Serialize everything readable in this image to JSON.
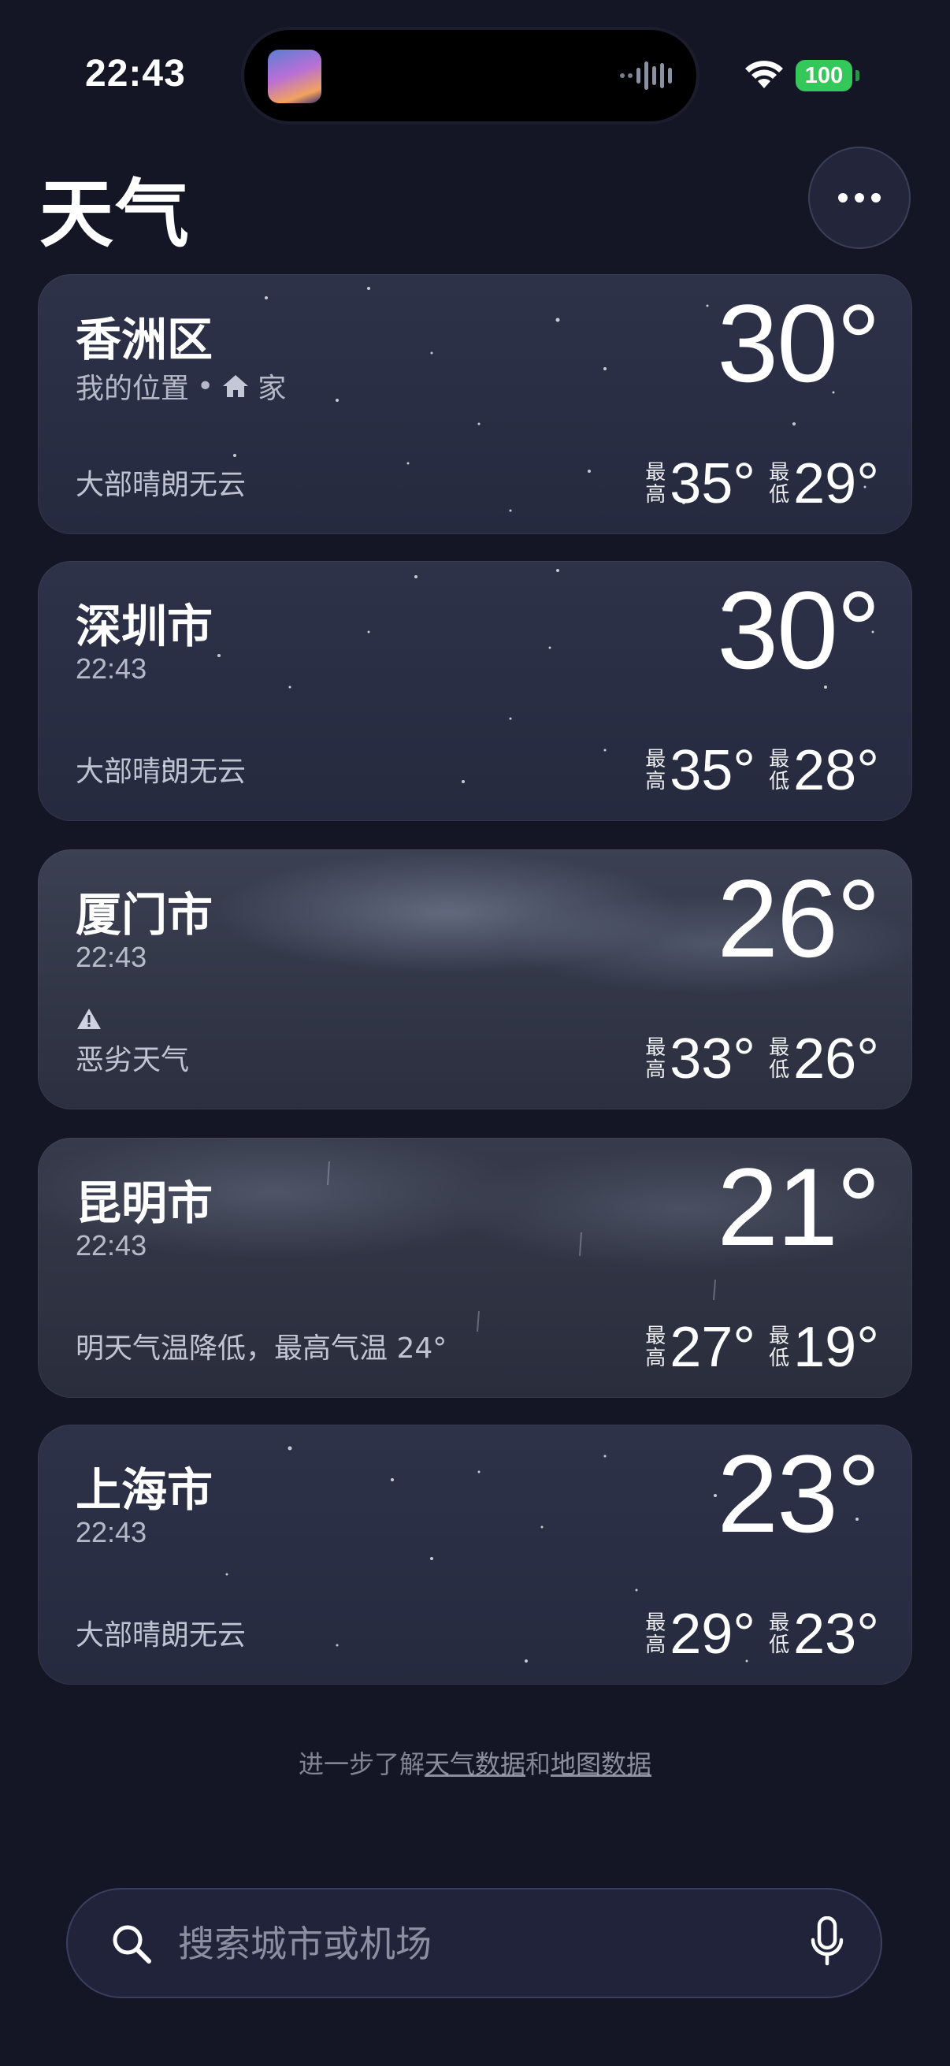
{
  "status_bar": {
    "time": "22:43",
    "battery": "100",
    "wifi_icon": "wifi-icon",
    "now_playing_icon": "audio-wave-icon"
  },
  "header": {
    "title": "天气",
    "more_icon": "ellipsis-icon"
  },
  "labels": {
    "high": "最高",
    "low": "最低"
  },
  "cards": [
    {
      "city": "香洲区",
      "subtitle": "我的位置",
      "separator": "•",
      "home_label": "家",
      "condition": "大部晴朗无云",
      "temp": "30°",
      "high": "35°",
      "low": "29°",
      "style": "night-clear"
    },
    {
      "city": "深圳市",
      "subtitle": "22:43",
      "condition": "大部晴朗无云",
      "temp": "30°",
      "high": "35°",
      "low": "28°",
      "style": "night-clear"
    },
    {
      "city": "厦门市",
      "subtitle": "22:43",
      "condition": "恶劣天气",
      "alert_icon": "warning-icon",
      "temp": "26°",
      "high": "33°",
      "low": "26°",
      "style": "cloudy"
    },
    {
      "city": "昆明市",
      "subtitle": "22:43",
      "condition": "明天气温降低，最高气温 24°",
      "temp": "21°",
      "high": "27°",
      "low": "19°",
      "style": "overcast"
    },
    {
      "city": "上海市",
      "subtitle": "22:43",
      "condition": "大部晴朗无云",
      "temp": "23°",
      "high": "29°",
      "low": "23°",
      "style": "night-clear"
    }
  ],
  "footer": {
    "prefix": "进一步了解",
    "link1": "天气数据",
    "middle": "和",
    "link2": "地图数据"
  },
  "search": {
    "placeholder": "搜索城市或机场",
    "value": "",
    "search_icon": "magnifier-icon",
    "mic_icon": "microphone-icon"
  },
  "colors": {
    "background": "#141625",
    "card": "#2a2e45",
    "battery": "#34c759"
  }
}
